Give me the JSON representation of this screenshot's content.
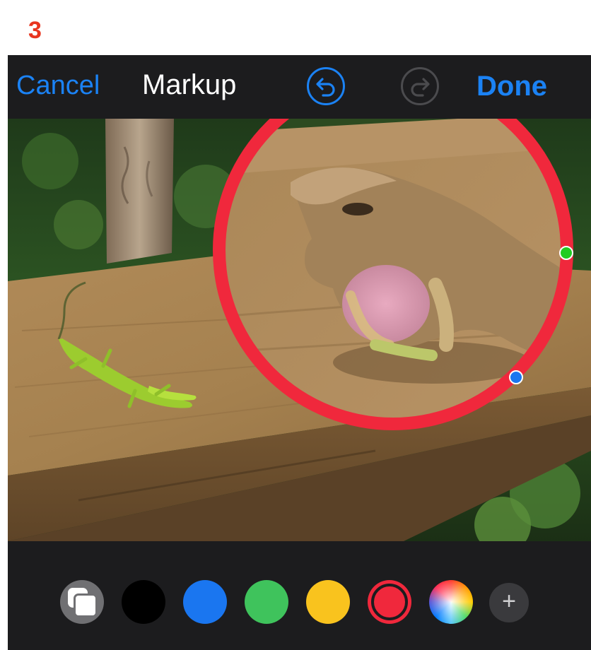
{
  "step_label": "3",
  "toolbar": {
    "cancel_label": "Cancel",
    "title": "Markup",
    "done_label": "Done",
    "undo_icon": "undo-icon",
    "redo_icon": "redo-icon",
    "redo_enabled": false
  },
  "canvas": {
    "subject": "lizard-photo",
    "magnifier_color": "#f0283c",
    "handle_colors": [
      "#22cc22",
      "#1a76f0"
    ]
  },
  "palette": {
    "items": [
      {
        "name": "layers",
        "icon": "layers-icon"
      },
      {
        "name": "black",
        "color": "#000000"
      },
      {
        "name": "blue",
        "color": "#1a76f0"
      },
      {
        "name": "green",
        "color": "#3fc35c"
      },
      {
        "name": "yellow",
        "color": "#f9c31e"
      },
      {
        "name": "red",
        "color": "#f0283c",
        "selected": true
      },
      {
        "name": "color-wheel",
        "icon": "color-wheel-icon"
      },
      {
        "name": "add",
        "label": "+"
      }
    ]
  },
  "colors": {
    "accent": "#1b82f4",
    "bar_background": "#1c1c1e",
    "step_number": "#e8351f"
  }
}
